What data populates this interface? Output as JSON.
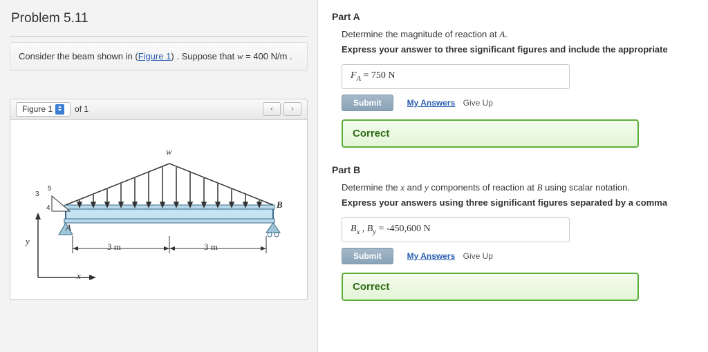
{
  "problem": {
    "title": "Problem 5.11",
    "statement_prefix": "Consider the beam shown in (",
    "figure_link": "Figure 1",
    "statement_suffix": ") . Suppose that ",
    "given_var": "w",
    "given_eq": " = 400  N/m .",
    "figure_label": "Figure 1",
    "figure_of": "of 1"
  },
  "figure": {
    "label_w": "w",
    "label_B": "B",
    "label_A": "A",
    "label_y": "y",
    "label_x": "x",
    "dim1": "3 m",
    "dim2": "3 m",
    "tick3": "3",
    "tick4": "4",
    "tick5": "5"
  },
  "partA": {
    "title": "Part A",
    "prompt_prefix": "Determine the magnitude of reaction at ",
    "prompt_var": "A",
    "prompt_suffix": ".",
    "instruct": "Express your answer to three significant figures and include the appropriate",
    "ans_lhs": "F",
    "ans_sub": "A",
    "ans_eq": " =  ",
    "ans_val": "750 N",
    "submit": "Submit",
    "myanswers": "My Answers",
    "giveup": "Give Up",
    "feedback": "Correct"
  },
  "partB": {
    "title": "Part B",
    "prompt_p1": "Determine the ",
    "prompt_x": "x",
    "prompt_and": " and ",
    "prompt_y": "y",
    "prompt_p2": " components of reaction at ",
    "prompt_var": "B",
    "prompt_p3": " using scalar notation.",
    "instruct": "Express your answers using three significant figures separated by a comma",
    "ans_b": "B",
    "ans_subx": "x",
    "ans_comma": " , ",
    "ans_suby": "y",
    "ans_eq": " =  ",
    "ans_val": "-450,600   N",
    "submit": "Submit",
    "myanswers": "My Answers",
    "giveup": "Give Up",
    "feedback": "Correct"
  }
}
